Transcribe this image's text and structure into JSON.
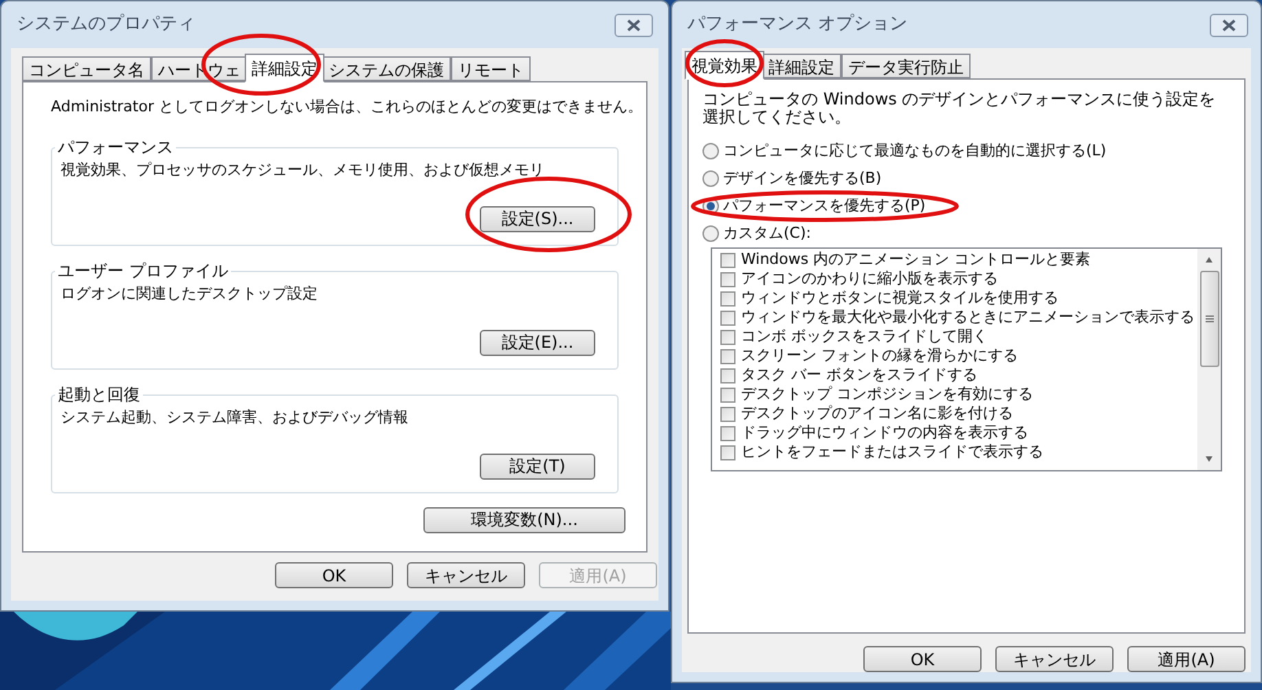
{
  "system_properties": {
    "title": "システムのプロパティ",
    "tabs": [
      {
        "label": "コンピュータ名",
        "selected": false
      },
      {
        "label": "ハードウェ",
        "selected": false
      },
      {
        "label": "詳細設定",
        "selected": true
      },
      {
        "label": "システムの保護",
        "selected": false
      },
      {
        "label": "リモート",
        "selected": false
      }
    ],
    "notice": "Administrator としてログオンしない場合は、これらのほとんどの変更はできません。",
    "groups": [
      {
        "title": "パフォーマンス",
        "description": "視覚効果、プロセッサのスケジュール、メモリ使用、および仮想メモリ",
        "button": "設定(S)..."
      },
      {
        "title": "ユーザー プロファイル",
        "description": "ログオンに関連したデスクトップ設定",
        "button": "設定(E)..."
      },
      {
        "title": "起動と回復",
        "description": "システム起動、システム障害、およびデバッグ情報",
        "button": "設定(T)"
      }
    ],
    "extra_button": "環境変数(N)...",
    "buttons": [
      {
        "label": "OK",
        "disabled": false
      },
      {
        "label": "キャンセル",
        "disabled": false
      },
      {
        "label": "適用(A)",
        "disabled": true
      }
    ]
  },
  "performance_options": {
    "title": "パフォーマンス オプション",
    "tabs": [
      {
        "label": "視覚効果",
        "selected": true
      },
      {
        "label": "詳細設定",
        "selected": false
      },
      {
        "label": "データ実行防止",
        "selected": false
      }
    ],
    "description": "コンピュータの Windows のデザインとパフォーマンスに使う設定を選択してください。",
    "options": [
      {
        "label": "コンピュータに応じて最適なものを自動的に選択する(L)",
        "selected": false
      },
      {
        "label": "デザインを優先する(B)",
        "selected": false
      },
      {
        "label": "パフォーマンスを優先する(P)",
        "selected": true
      },
      {
        "label": "カスタム(C):",
        "selected": false
      }
    ],
    "effects": [
      {
        "label": "Windows 内のアニメーション コントロールと要素",
        "checked": false
      },
      {
        "label": "アイコンのかわりに縮小版を表示する",
        "checked": false
      },
      {
        "label": "ウィンドウとボタンに視覚スタイルを使用する",
        "checked": false
      },
      {
        "label": "ウィンドウを最大化や最小化するときにアニメーションで表示する",
        "checked": false
      },
      {
        "label": "コンボ ボックスをスライドして開く",
        "checked": false
      },
      {
        "label": "スクリーン フォントの縁を滑らかにする",
        "checked": false
      },
      {
        "label": "タスク バー ボタンをスライドする",
        "checked": false
      },
      {
        "label": "デスクトップ コンポジションを有効にする",
        "checked": false
      },
      {
        "label": "デスクトップのアイコン名に影を付ける",
        "checked": false
      },
      {
        "label": "ドラッグ中にウィンドウの内容を表示する",
        "checked": false
      },
      {
        "label": "ヒントをフェードまたはスライドで表示する",
        "checked": false
      }
    ],
    "buttons": [
      {
        "label": "OK",
        "disabled": false
      },
      {
        "label": "キャンセル",
        "disabled": false
      },
      {
        "label": "適用(A)",
        "disabled": false
      }
    ]
  }
}
